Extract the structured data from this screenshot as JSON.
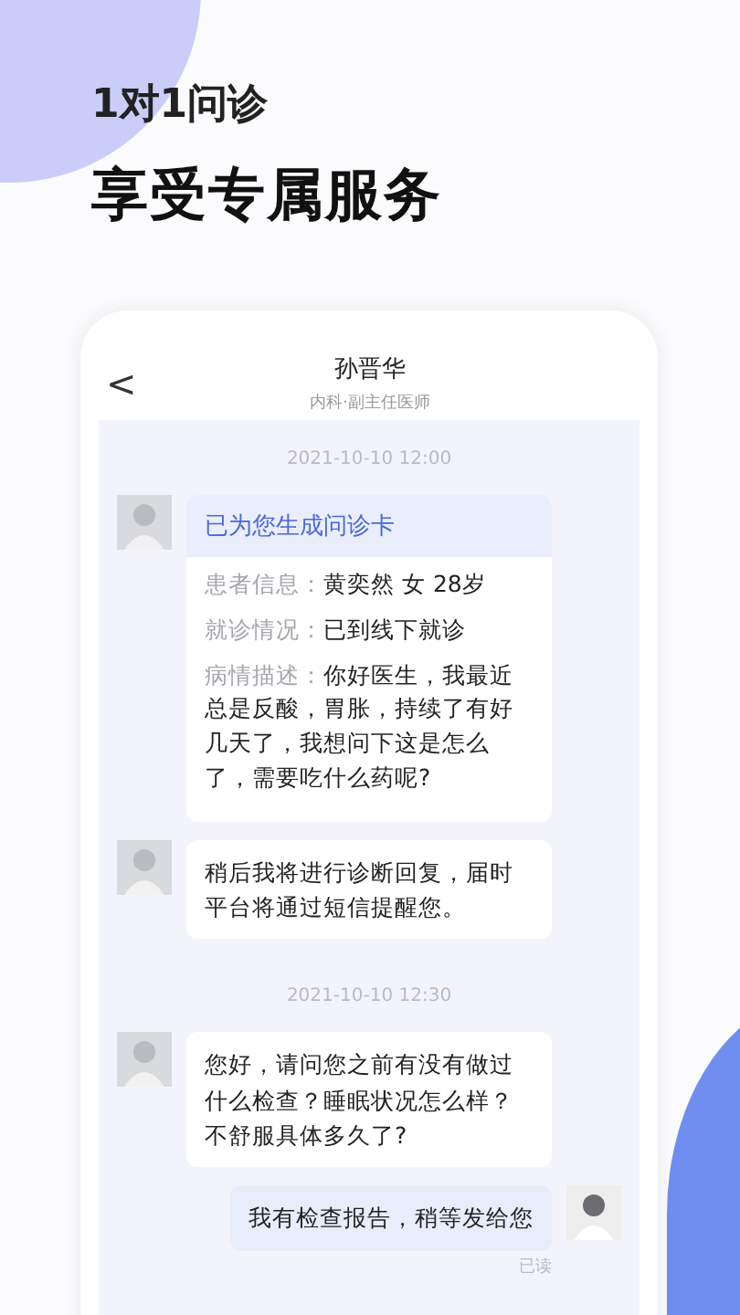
{
  "headline": {
    "subtitle": "1对1问诊",
    "title": "享受专属服务"
  },
  "chat_header": {
    "back": "<",
    "name": "孙晋华",
    "department": "内科·副主任医师"
  },
  "messages": [
    {
      "kind": "time",
      "text": "2021-10-10  12:00"
    },
    {
      "kind": "card",
      "title": "已为您生成问诊卡",
      "fields": [
        {
          "label": "患者信息：",
          "value": "黄奕然  女  28岁"
        },
        {
          "label": "就诊情况：",
          "value": "已到线下就诊"
        },
        {
          "label": "病情描述：",
          "value": "你好医生，我最近总是反酸，胃胀，持续了有好几天了，我想问下这是怎么了，需要吃什么药呢?"
        }
      ]
    },
    {
      "kind": "doctor",
      "text": "稍后我将进行诊断回复，届时平台将通过短信提醒您。"
    },
    {
      "kind": "time",
      "text": "2021-10-10  12:30"
    },
    {
      "kind": "doctor",
      "text": "您好，请问您之前有没有做过什么检查？睡眠状况怎么样？不舒服具体多久了?"
    },
    {
      "kind": "mine",
      "text": "我有检查报告，稍等发给您",
      "status": "已读"
    }
  ]
}
